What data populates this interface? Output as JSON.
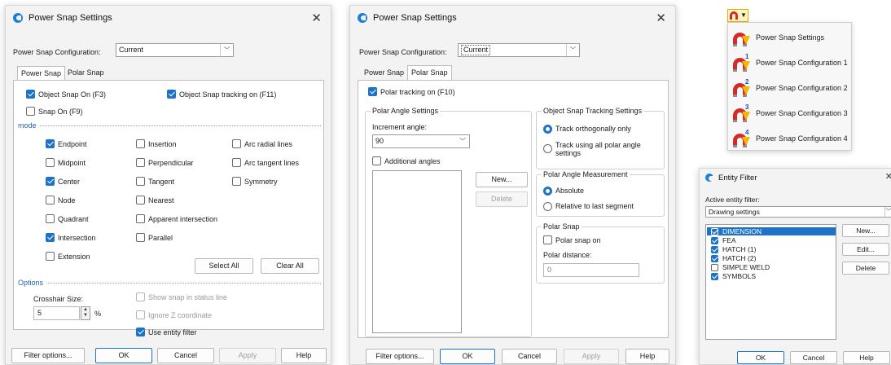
{
  "dialog1": {
    "title": "Power Snap Settings",
    "close": "✕",
    "config_label": "Power Snap Configuration:",
    "config_value": "Current",
    "tabs": [
      "Power Snap",
      "Polar Snap"
    ],
    "object_snap_on": "Object Snap On (F3)",
    "object_snap_tracking": "Object Snap tracking on (F11)",
    "snap_on": "Snap On (F9)",
    "mode_label": "mode",
    "modes": {
      "endpoint": "Endpoint",
      "midpoint": "Midpoint",
      "center": "Center",
      "node": "Node",
      "quadrant": "Quadrant",
      "intersection": "Intersection",
      "extension": "Extension",
      "insertion": "Insertion",
      "perpendicular": "Perpendicular",
      "tangent": "Tangent",
      "nearest": "Nearest",
      "apparent": "Apparent intersection",
      "parallel": "Parallel",
      "arc_radial": "Arc radial lines",
      "arc_tangent": "Arc tangent lines",
      "symmetry": "Symmetry"
    },
    "select_all": "Select All",
    "clear_all": "Clear All",
    "options_label": "Options",
    "crosshair_label": "Crosshair Size:",
    "crosshair_value": "5",
    "crosshair_unit": "%",
    "show_snap": "Show snap in status line",
    "ignore_z": "Ignore Z coordinate",
    "use_entity_filter": "Use entity filter",
    "buttons": {
      "filter": "Filter options...",
      "ok": "OK",
      "cancel": "Cancel",
      "apply": "Apply",
      "help": "Help"
    }
  },
  "dialog2": {
    "title": "Power Snap Settings",
    "close": "✕",
    "config_label": "Power Snap Configuration:",
    "config_value": "Current",
    "tabs": [
      "Power Snap",
      "Polar Snap"
    ],
    "polar_tracking": "Polar tracking on (F10)",
    "polar_angle_settings": "Polar Angle Settings",
    "increment_label": "Increment angle:",
    "increment_value": "90",
    "additional_angles": "Additional angles",
    "new": "New...",
    "delete": "Delete",
    "ost_title": "Object Snap Tracking Settings",
    "track_ortho": "Track orthogonally only",
    "track_all": "Track using all polar angle settings",
    "pam_title": "Polar Angle Measurement",
    "absolute": "Absolute",
    "relative": "Relative to last segment",
    "polar_snap_title": "Polar Snap",
    "polar_snap_on": "Polar snap on",
    "polar_distance_label": "Polar distance:",
    "polar_distance_value": "0",
    "buttons": {
      "filter": "Filter options...",
      "ok": "OK",
      "cancel": "Cancel",
      "apply": "Apply",
      "help": "Help"
    }
  },
  "menu": {
    "items": [
      {
        "label": "Power Snap Settings",
        "num": ""
      },
      {
        "label": "Power Snap Configuration 1",
        "num": "1"
      },
      {
        "label": "Power Snap Configuration 2",
        "num": "2"
      },
      {
        "label": "Power Snap Configuration 3",
        "num": "3"
      },
      {
        "label": "Power Snap Configuration 4",
        "num": "4"
      }
    ]
  },
  "entity_filter": {
    "title": "Entity Filter",
    "close": "✕",
    "active_label": "Active entity filter:",
    "active_value": "Drawing settings",
    "items": [
      {
        "label": "DIMENSION",
        "checked": true
      },
      {
        "label": "FEA",
        "checked": true
      },
      {
        "label": "HATCH (1)",
        "checked": true
      },
      {
        "label": "HATCH (2)",
        "checked": true
      },
      {
        "label": "SIMPLE WELD",
        "checked": false
      },
      {
        "label": "SYMBOLS",
        "checked": true
      }
    ],
    "new": "New...",
    "edit": "Edit...",
    "delete": "Delete",
    "ok": "OK",
    "cancel": "Cancel",
    "help": "Help"
  }
}
